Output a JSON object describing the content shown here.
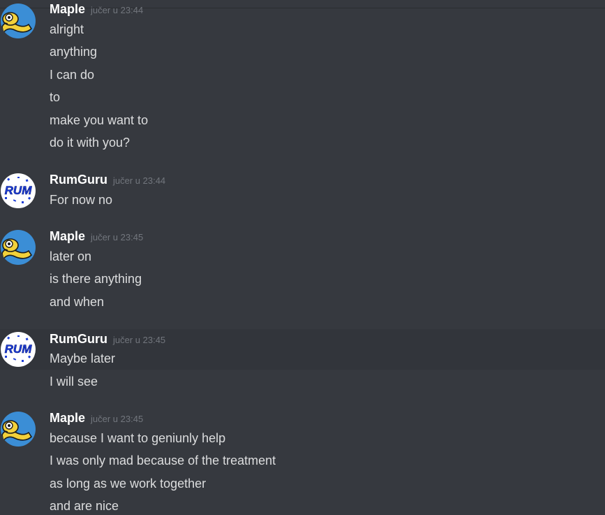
{
  "messages": [
    {
      "author": "Maple",
      "timestamp": "jučer u 23:44",
      "lines": [
        "alright",
        "anything",
        "I can do",
        "to",
        "make you want to",
        "do it with you?"
      ]
    },
    {
      "author": "RumGuru",
      "timestamp": "jučer u 23:44",
      "lines": [
        "For now no"
      ]
    },
    {
      "author": "Maple",
      "timestamp": "jučer u 23:45",
      "lines": [
        "later on",
        "is there anything",
        "and when"
      ]
    },
    {
      "author": "RumGuru",
      "timestamp": "jučer u 23:45",
      "lines": [
        "Maybe later",
        "I will see"
      ]
    },
    {
      "author": "Maple",
      "timestamp": "jučer u 23:45",
      "lines": [
        "because I want to geniunly help",
        "I was only mad because of the treatment",
        "as long as we work together",
        "and are nice"
      ]
    }
  ],
  "avatars": {
    "maple": "snake-avatar-icon",
    "rumguru": "rum-logo-avatar-icon",
    "rum_logo_text": "RUM"
  },
  "colors": {
    "background": "#36393f",
    "hover": "#32353b",
    "username": "#ffffff",
    "text": "#dcddde",
    "timestamp": "#72767d",
    "maple_avatar": "#3b8ed6",
    "rum_blue": "#1e3fd6"
  }
}
